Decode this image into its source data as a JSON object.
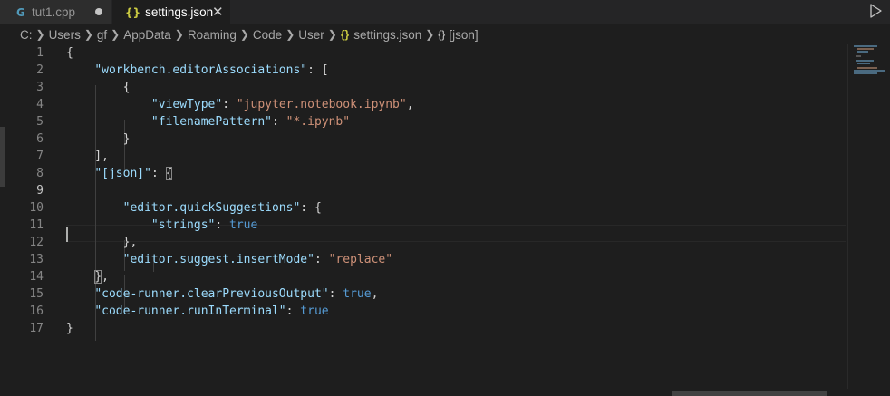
{
  "tabs": [
    {
      "label": "tut1.cpp",
      "icon": "cpp-file-icon",
      "icon_glyph": "G",
      "state": "modified"
    },
    {
      "label": "settings.json",
      "icon": "json-file-icon",
      "icon_glyph": "{}",
      "state": "active"
    }
  ],
  "breadcrumb": {
    "segments": [
      "C:",
      "Users",
      "gf",
      "AppData",
      "Roaming",
      "Code",
      "User"
    ],
    "file": "settings.json",
    "file_icon_glyph": "{}",
    "symbol_icon_glyph": "{}",
    "symbol": "[json]"
  },
  "editor": {
    "active_line": 9,
    "lines": [
      {
        "n": "1",
        "tokens": [
          {
            "t": "p",
            "v": "{"
          }
        ]
      },
      {
        "n": "2",
        "tokens": [
          {
            "t": "p",
            "v": "    "
          },
          {
            "t": "k",
            "v": "\"workbench.editorAssociations\""
          },
          {
            "t": "p",
            "v": ": ["
          }
        ]
      },
      {
        "n": "3",
        "tokens": [
          {
            "t": "p",
            "v": "        {"
          }
        ]
      },
      {
        "n": "4",
        "tokens": [
          {
            "t": "p",
            "v": "            "
          },
          {
            "t": "k",
            "v": "\"viewType\""
          },
          {
            "t": "p",
            "v": ": "
          },
          {
            "t": "s",
            "v": "\"jupyter.notebook.ipynb\""
          },
          {
            "t": "p",
            "v": ","
          }
        ]
      },
      {
        "n": "5",
        "tokens": [
          {
            "t": "p",
            "v": "            "
          },
          {
            "t": "k",
            "v": "\"filenamePattern\""
          },
          {
            "t": "p",
            "v": ": "
          },
          {
            "t": "s",
            "v": "\"*.ipynb\""
          }
        ]
      },
      {
        "n": "6",
        "tokens": [
          {
            "t": "p",
            "v": "        }"
          }
        ]
      },
      {
        "n": "7",
        "tokens": [
          {
            "t": "p",
            "v": "    ],"
          }
        ]
      },
      {
        "n": "8",
        "tokens": [
          {
            "t": "p",
            "v": "    "
          },
          {
            "t": "k",
            "v": "\"[json]\""
          },
          {
            "t": "p",
            "v": ": "
          },
          {
            "t": "m",
            "v": "{"
          }
        ]
      },
      {
        "n": "9",
        "tokens": []
      },
      {
        "n": "10",
        "tokens": [
          {
            "t": "p",
            "v": "        "
          },
          {
            "t": "k",
            "v": "\"editor.quickSuggestions\""
          },
          {
            "t": "p",
            "v": ": {"
          }
        ]
      },
      {
        "n": "11",
        "tokens": [
          {
            "t": "p",
            "v": "            "
          },
          {
            "t": "k",
            "v": "\"strings\""
          },
          {
            "t": "p",
            "v": ": "
          },
          {
            "t": "b",
            "v": "true"
          }
        ]
      },
      {
        "n": "12",
        "tokens": [
          {
            "t": "p",
            "v": "        },"
          }
        ]
      },
      {
        "n": "13",
        "tokens": [
          {
            "t": "p",
            "v": "        "
          },
          {
            "t": "k",
            "v": "\"editor.suggest.insertMode\""
          },
          {
            "t": "p",
            "v": ": "
          },
          {
            "t": "s",
            "v": "\"replace\""
          }
        ]
      },
      {
        "n": "14",
        "tokens": [
          {
            "t": "p",
            "v": "    "
          },
          {
            "t": "m",
            "v": "}"
          },
          {
            "t": "p",
            "v": ","
          }
        ]
      },
      {
        "n": "15",
        "tokens": [
          {
            "t": "p",
            "v": "    "
          },
          {
            "t": "k",
            "v": "\"code-runner.clearPreviousOutput\""
          },
          {
            "t": "p",
            "v": ": "
          },
          {
            "t": "b",
            "v": "true"
          },
          {
            "t": "p",
            "v": ","
          }
        ]
      },
      {
        "n": "16",
        "tokens": [
          {
            "t": "p",
            "v": "    "
          },
          {
            "t": "k",
            "v": "\"code-runner.runInTerminal\""
          },
          {
            "t": "p",
            "v": ": "
          },
          {
            "t": "b",
            "v": "true"
          }
        ]
      },
      {
        "n": "17",
        "tokens": [
          {
            "t": "p",
            "v": "}"
          }
        ]
      }
    ]
  },
  "colors": {
    "editor_bg": "#1e1e1e",
    "tabbar_bg": "#252526",
    "json_key": "#9cdcfe",
    "json_string": "#ce9178",
    "json_bool": "#569cd6",
    "line_number": "#858585",
    "cpp_icon": "#519aba",
    "json_icon": "#cbcb41"
  },
  "icons": {
    "run": "play-icon",
    "close": "close-icon",
    "dirty": "unsaved-dot-icon",
    "separator": "chevron-right-icon"
  }
}
